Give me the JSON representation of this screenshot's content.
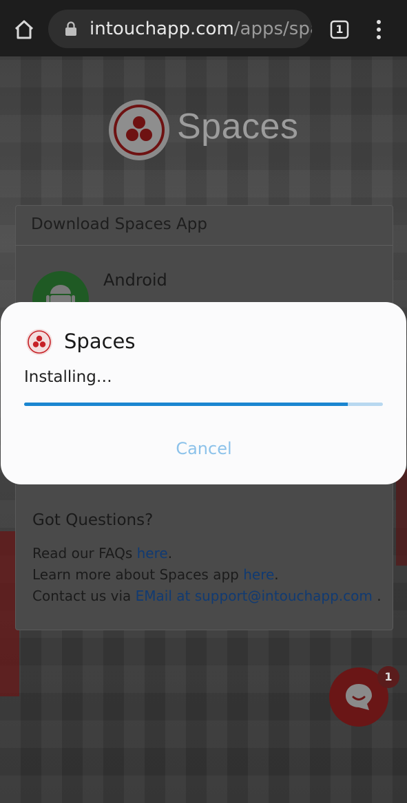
{
  "browser": {
    "url_domain": "intouchapp.com",
    "url_path": "/apps/spac",
    "tab_count": "1"
  },
  "page": {
    "logo_text": "Spaces",
    "card": {
      "title": "Download Spaces App",
      "android_label": "Android"
    },
    "questions": {
      "title": "Got Questions?",
      "line1_prefix": "Read our FAQs ",
      "line1_link": "here",
      "line1_suffix": ".",
      "line2_prefix": "Learn more about Spaces app ",
      "line2_link": "here",
      "line2_suffix": ".",
      "line3_prefix": "Contact us via ",
      "line3_link": "EMail at support@intouchapp.com",
      "line3_suffix": " ."
    },
    "chat": {
      "badge_count": "1"
    }
  },
  "dialog": {
    "app_name": "Spaces",
    "status": "Installing…",
    "progress": 0.902,
    "cancel_label": "Cancel"
  },
  "colors": {
    "brand_red": "#c62026",
    "progress": "#1a86d0",
    "cancel": "#8cc2ea"
  }
}
